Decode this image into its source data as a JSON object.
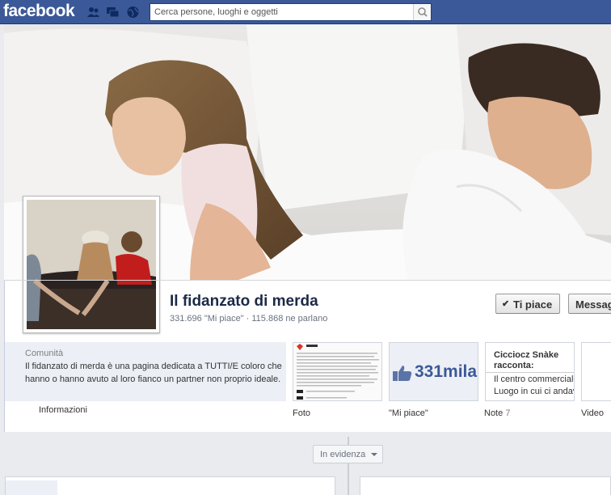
{
  "topbar": {
    "logo": "facebook",
    "search_placeholder": "Cerca persone, luoghi e oggetti"
  },
  "page": {
    "name": "Il fidanzato di merda",
    "stats": "331.696 \"Mi piace\" · 115.868 ne parlano",
    "like_button": "Ti piace",
    "message_button": "Messag"
  },
  "about": {
    "category": "Comunità",
    "description": "Il fidanzato di merda è una pagina dedicata a TUTTI/E coloro che hanno o hanno avuto al loro fianco un partner non proprio ideale.",
    "info_link": "Informazioni"
  },
  "thumbs": {
    "photos_label": "Foto",
    "likes_number": "331mila",
    "likes_label": "\"Mi piace\"",
    "notes_label": "Note",
    "notes_count": "7",
    "note_title": "Cicciocz Snàke racconta:",
    "note_line1": "Il centro commerciale",
    "note_line2": "Luogo in cui ci andav",
    "video_label": "Video"
  },
  "timeline": {
    "filter": "In evidenza"
  },
  "colors": {
    "brand": "#3b5998",
    "link": "#3b5998"
  }
}
